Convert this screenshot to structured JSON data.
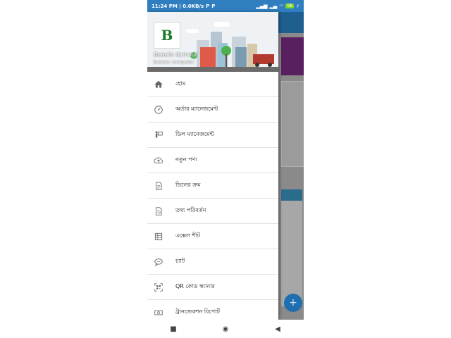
{
  "status": {
    "time_data": "11:24 PM | 0.0KB/s",
    "battery": "98"
  },
  "header": {
    "logo_letter": "B",
    "user_name": "Beaute damour",
    "user_email": "beacon computer"
  },
  "menu": [
    {
      "label": "হোম",
      "icon": "home-icon"
    },
    {
      "label": "অর্ডার ম্যানেজমেন্ট",
      "icon": "gauge-icon"
    },
    {
      "label": "ডিল ম্যানেজমেন্ট",
      "icon": "presenter-icon"
    },
    {
      "label": "নতুন পণ্য",
      "icon": "cloud-upload-icon"
    },
    {
      "label": "ডিলের ক্রম",
      "icon": "document-icon"
    },
    {
      "label": "তথ্য পরিবর্তন",
      "icon": "document-edit-icon"
    },
    {
      "label": "এক্সেল শীট",
      "icon": "spreadsheet-icon"
    },
    {
      "label": "চ্যাট",
      "icon": "chat-icon"
    },
    {
      "label": "QR কোড স্ক্যানার",
      "icon": "qr-scanner-icon"
    },
    {
      "label": "ট্রানজেকশন রিপোর্ট",
      "icon": "money-icon"
    }
  ],
  "colors": {
    "status_bar": "#2f7fc0",
    "drawer_bg": "#ffffff",
    "logo_green": "#1d7a2a"
  }
}
